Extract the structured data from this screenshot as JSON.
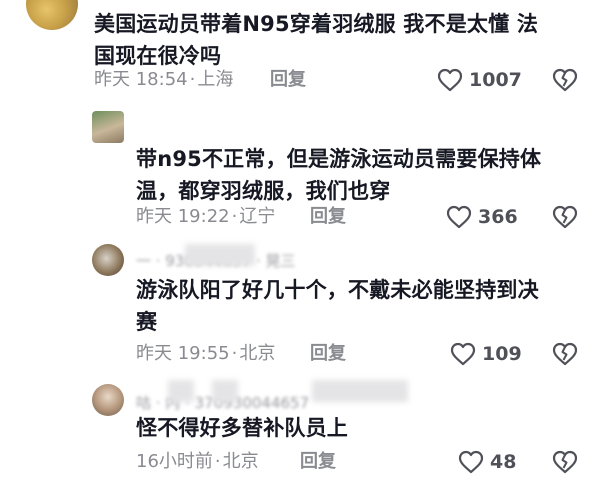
{
  "comments": [
    {
      "text_line1": "美国运动员带着N95穿着羽绒服 我不是太懂 法",
      "text_line2": "国现在很冷吗",
      "time": "昨天 18:54",
      "location": "上海",
      "reply_label": "回复",
      "likes": "1007"
    },
    {
      "text_line1": "带n95不正常，但是游泳运动员需要保持体",
      "text_line2": "温，都穿羽绒服，我们也穿",
      "time": "昨天 19:22",
      "location": "辽宁",
      "reply_label": "回复",
      "likes": "366"
    },
    {
      "author_blurred": "一 · 930044657 · 晃三",
      "text_line1": "游泳队阳了好几十个，不戴未必能坚持到决",
      "text_line2": "赛",
      "time": "昨天 19:55",
      "location": "北京",
      "reply_label": "回复",
      "likes": "109"
    },
    {
      "author_blurred": "咕 · 内 · 370930044657",
      "text_line1": "怪不得好多替补队员上",
      "time": "16小时前",
      "location": "北京",
      "reply_label": "回复",
      "likes": "48"
    }
  ],
  "colors": {
    "text": "#161823",
    "meta": "#8a8b91",
    "icon": "#505158"
  },
  "icons": {
    "like": "heart-outline-icon",
    "dislike": "broken-heart-icon"
  }
}
